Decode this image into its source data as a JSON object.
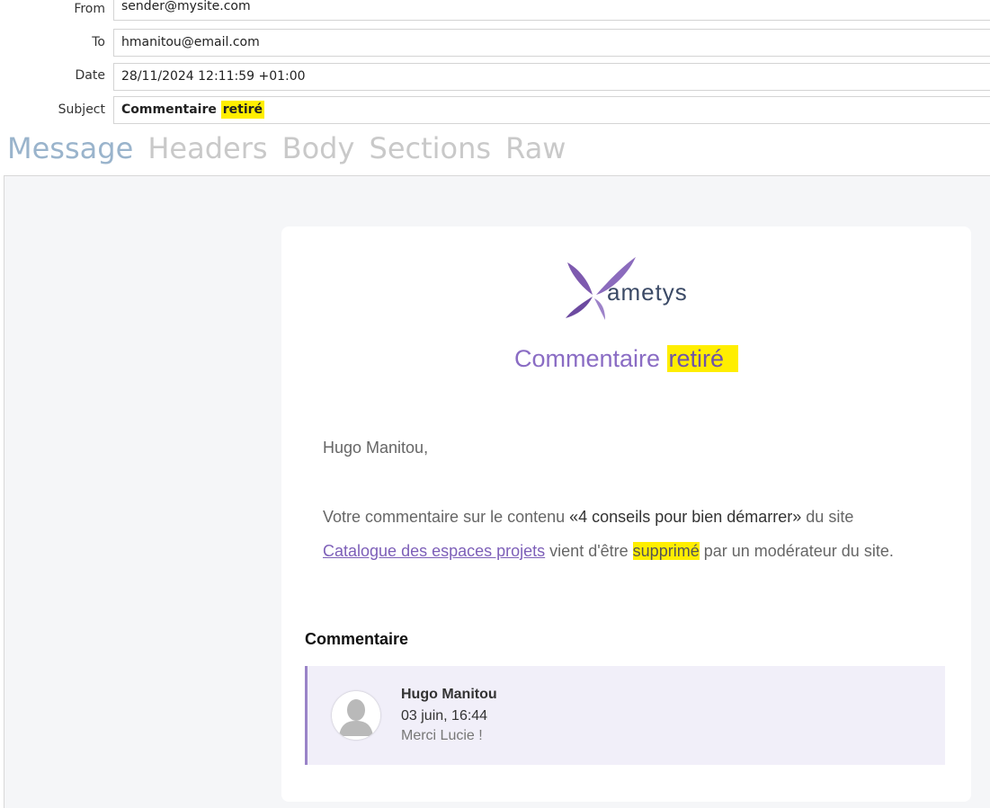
{
  "headers": {
    "from_label": "From",
    "from_value": "sender@mysite.com",
    "to_label": "To",
    "to_value": "hmanitou@email.com",
    "date_label": "Date",
    "date_value": "28/11/2024 12:11:59 +01:00",
    "subject_label": "Subject",
    "subject_prefix": "Commentaire",
    "subject_highlight": "retiré"
  },
  "tabs": [
    "Message",
    "Headers",
    "Body",
    "Sections",
    "Raw"
  ],
  "active_tab": "Message",
  "email": {
    "logo_text": "ametys",
    "title_prefix": "Commentaire",
    "title_highlight": "retiré",
    "greeting": "Hugo Manitou,",
    "line1_a": "Votre commentaire sur le contenu ",
    "line1_b": "«4 conseils pour bien démarrer»",
    "line1_c": " du site",
    "line2_link": "Catalogue des espaces projets",
    "line2_a": " vient d'être ",
    "line2_highlight": "supprimé",
    "line2_b": " par un modérateur du site.",
    "comment_heading": "Commentaire",
    "comment": {
      "author": "Hugo Manitou",
      "date": "03 juin, 16:44",
      "text": "Merci Lucie !"
    }
  },
  "colors": {
    "highlight": "#ffee00",
    "accent": "#8a6cc4",
    "tab_active": "#9ab4cc",
    "tab_inactive": "#c9c9c9"
  }
}
